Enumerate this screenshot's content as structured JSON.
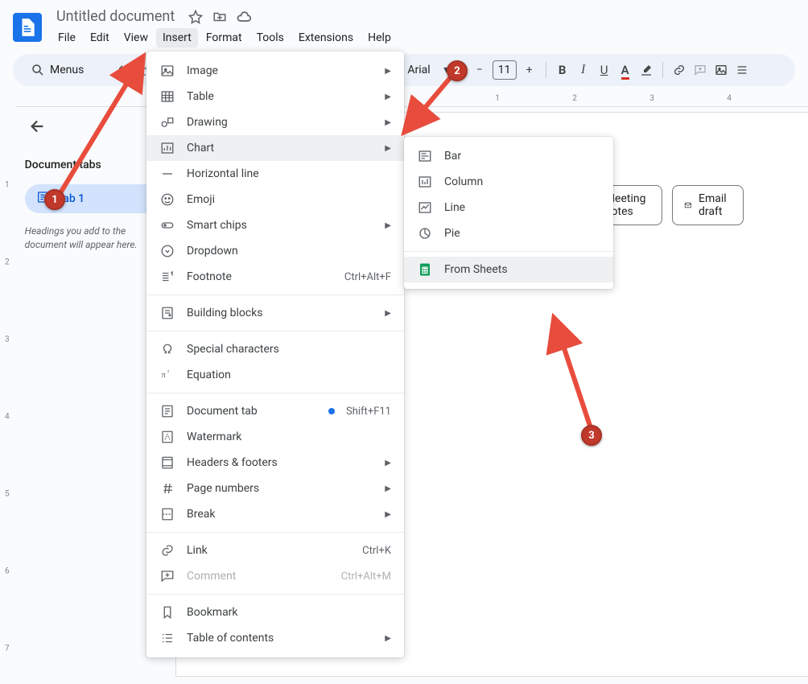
{
  "header": {
    "doc_title": "Untitled document",
    "menus": [
      "File",
      "Edit",
      "View",
      "Insert",
      "Format",
      "Tools",
      "Extensions",
      "Help"
    ],
    "active_menu_index": 3
  },
  "toolbar": {
    "menus_label": "Menus",
    "font_name": "Arial",
    "font_size": "11"
  },
  "ruler": {
    "h_numbers": [
      "1",
      "2",
      "3",
      "4"
    ],
    "v_numbers": [
      "1",
      "2",
      "3",
      "4",
      "5",
      "6",
      "7"
    ]
  },
  "sidebar": {
    "title": "Document tabs",
    "tab_label": "Tab 1",
    "hint": "Headings you add to the document will appear here."
  },
  "page_chips": {
    "meeting": "Meeting notes",
    "email": "Email draft"
  },
  "insert_menu": [
    {
      "icon": "image",
      "label": "Image",
      "arrow": true
    },
    {
      "icon": "table",
      "label": "Table",
      "arrow": true
    },
    {
      "icon": "drawing",
      "label": "Drawing",
      "arrow": true
    },
    {
      "icon": "chart",
      "label": "Chart",
      "arrow": true,
      "highlight": true
    },
    {
      "icon": "hline",
      "label": "Horizontal line"
    },
    {
      "icon": "emoji",
      "label": "Emoji"
    },
    {
      "icon": "chips",
      "label": "Smart chips",
      "arrow": true
    },
    {
      "icon": "dropdown",
      "label": "Dropdown"
    },
    {
      "icon": "footnote",
      "label": "Footnote",
      "shortcut": "Ctrl+Alt+F"
    },
    {
      "sep": true
    },
    {
      "icon": "blocks",
      "label": "Building blocks",
      "arrow": true
    },
    {
      "sep": true
    },
    {
      "icon": "omega",
      "label": "Special characters"
    },
    {
      "icon": "pi",
      "label": "Equation"
    },
    {
      "sep": true
    },
    {
      "icon": "doctab",
      "label": "Document tab",
      "dot": true,
      "shortcut": "Shift+F11"
    },
    {
      "icon": "watermark",
      "label": "Watermark"
    },
    {
      "icon": "headers",
      "label": "Headers & footers",
      "arrow": true
    },
    {
      "icon": "hash",
      "label": "Page numbers",
      "arrow": true
    },
    {
      "icon": "break",
      "label": "Break",
      "arrow": true
    },
    {
      "sep": true
    },
    {
      "icon": "link",
      "label": "Link",
      "shortcut": "Ctrl+K"
    },
    {
      "icon": "comment",
      "label": "Comment",
      "shortcut": "Ctrl+Alt+M",
      "disabled": true
    },
    {
      "sep": true
    },
    {
      "icon": "bookmark",
      "label": "Bookmark"
    },
    {
      "icon": "toc",
      "label": "Table of contents",
      "arrow": true
    }
  ],
  "chart_submenu": [
    {
      "icon": "bar-h",
      "label": "Bar"
    },
    {
      "icon": "bar-v",
      "label": "Column"
    },
    {
      "icon": "line",
      "label": "Line"
    },
    {
      "icon": "pie",
      "label": "Pie"
    },
    {
      "sep": true
    },
    {
      "icon": "sheets",
      "label": "From Sheets",
      "highlight": true
    }
  ],
  "annotations": {
    "a1": "1",
    "a2": "2",
    "a3": "3"
  }
}
